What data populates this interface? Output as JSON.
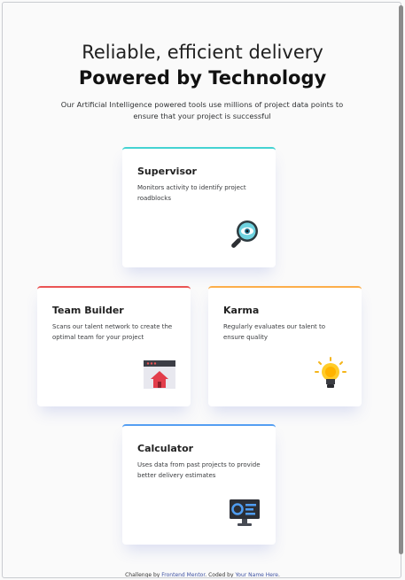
{
  "header": {
    "line1": "Reliable, efficient delivery",
    "line2": "Powered by Technology",
    "subtitle": "Our Artificial Intelligence powered tools use millions of project data points to ensure that your project is successful"
  },
  "cards": [
    {
      "title": "Supervisor",
      "desc": "Monitors activity to identify project roadblocks",
      "accent": "#44d3d2",
      "icon": "magnifier-eye-icon"
    },
    {
      "title": "Team Builder",
      "desc": "Scans our talent network to create the optimal team for your project",
      "accent": "#ea5454",
      "icon": "browser-home-icon"
    },
    {
      "title": "Karma",
      "desc": "Regularly evaluates our talent to ensure quality",
      "accent": "#fcae4a",
      "icon": "lightbulb-icon"
    },
    {
      "title": "Calculator",
      "desc": "Uses data from past projects to provide better delivery estimates",
      "accent": "#549ef2",
      "icon": "dashboard-monitor-icon"
    }
  ],
  "footer": {
    "prefix": "Challenge by",
    "link1": "Frontend Mentor",
    "middle": ". Coded by",
    "link2": "Your Name Here",
    "suffix": "."
  }
}
